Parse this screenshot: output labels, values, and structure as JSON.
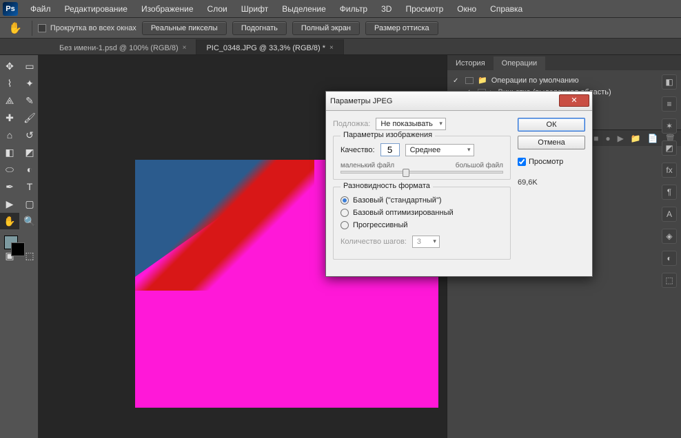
{
  "app": {
    "logo_text": "Ps"
  },
  "menu": [
    "Файл",
    "Редактирование",
    "Изображение",
    "Слои",
    "Шрифт",
    "Выделение",
    "Фильтр",
    "3D",
    "Просмотр",
    "Окно",
    "Справка"
  ],
  "options": {
    "scroll_all": "Прокрутка во всех окнах",
    "buttons": [
      "Реальные пикселы",
      "Подогнать",
      "Полный экран",
      "Размер оттиска"
    ]
  },
  "tabs": [
    {
      "label": "Без имени-1.psd @ 100% (RGB/8)",
      "active": false
    },
    {
      "label": "PIC_0348.JPG @ 33,3% (RGB/8) *",
      "active": true
    }
  ],
  "panels": {
    "tabs": [
      "История",
      "Операции"
    ],
    "active_tab": 1,
    "actions": [
      {
        "label": "Операции по умолчанию"
      },
      {
        "label": "Виньетка (выделенная область)"
      }
    ]
  },
  "dialog": {
    "title": "Параметры JPEG",
    "matte_label": "Подложка:",
    "matte_value": "Не показывать",
    "img_group": "Параметры изображения",
    "quality_label": "Качество:",
    "quality_value": "5",
    "quality_preset": "Среднее",
    "small_file": "маленький файл",
    "big_file": "большой файл",
    "fmt_group": "Разновидность формата",
    "fmt_options": [
      "Базовый (\"стандартный\")",
      "Базовый оптимизированный",
      "Прогрессивный"
    ],
    "fmt_selected": 0,
    "steps_label": "Количество шагов:",
    "steps_value": "3",
    "ok": "ОК",
    "cancel": "Отмена",
    "preview": "Просмотр",
    "filesize": "69,6K"
  }
}
